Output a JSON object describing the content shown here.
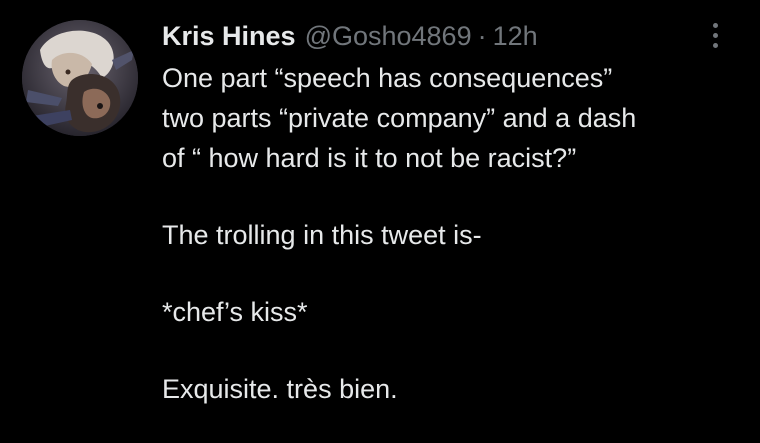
{
  "tweet": {
    "author": {
      "display_name": "Kris Hines",
      "handle": "@Gosho4869",
      "separator": "·",
      "timestamp": "12h",
      "avatar_icon": "artwork-avatar"
    },
    "more_icon": "more-vertical-icon",
    "text_lines": [
      "One part “speech has consequences”",
      "two parts “private company” and a dash",
      "of “ how hard is it to not be racist?”",
      "",
      "The trolling in this tweet is-",
      "",
      "*chef’s kiss*",
      "",
      "Exquisite. très bien."
    ]
  },
  "colors": {
    "background": "#000000",
    "primary_text": "#e7e9ea",
    "secondary_text": "#71767b"
  }
}
